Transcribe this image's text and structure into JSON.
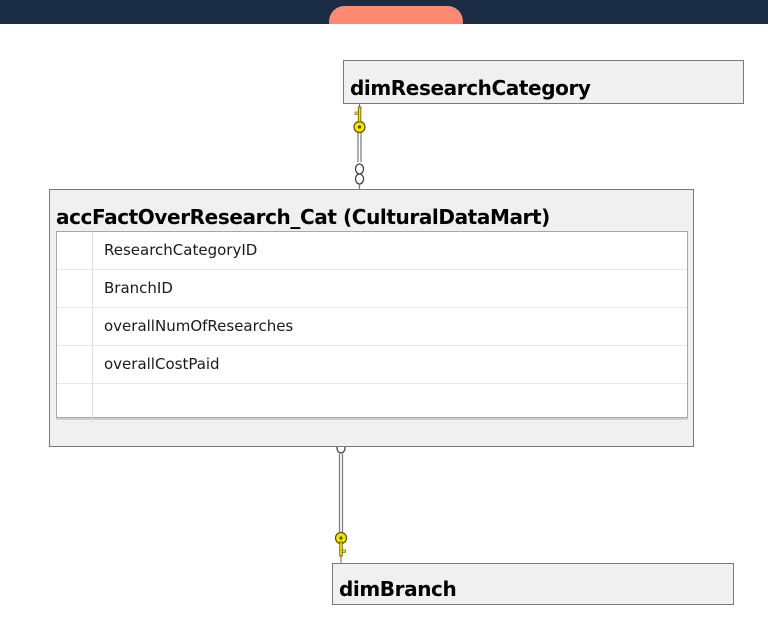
{
  "diagram": {
    "tables": {
      "research_category": {
        "title": "dimResearchCategory"
      },
      "fact": {
        "title": "accFactOverResearch_Cat (CulturalDataMart)",
        "columns": [
          "ResearchCategoryID",
          "BranchID",
          "overallNumOfResearches",
          "overallCostPaid"
        ]
      },
      "branch": {
        "title": "dimBranch"
      }
    },
    "relationships": [
      {
        "from": "fact",
        "to": "research_category",
        "one_end_icon": "key-icon",
        "many_end_icon": "infinity-icon"
      },
      {
        "from": "fact",
        "to": "branch",
        "one_end_icon": "key-icon",
        "many_end_icon": "infinity-icon"
      }
    ],
    "colors": {
      "topbar": "#1b2d45",
      "pill": "#ff8a73",
      "key": "#f5e400",
      "table_header": "#f0f0f0"
    }
  }
}
